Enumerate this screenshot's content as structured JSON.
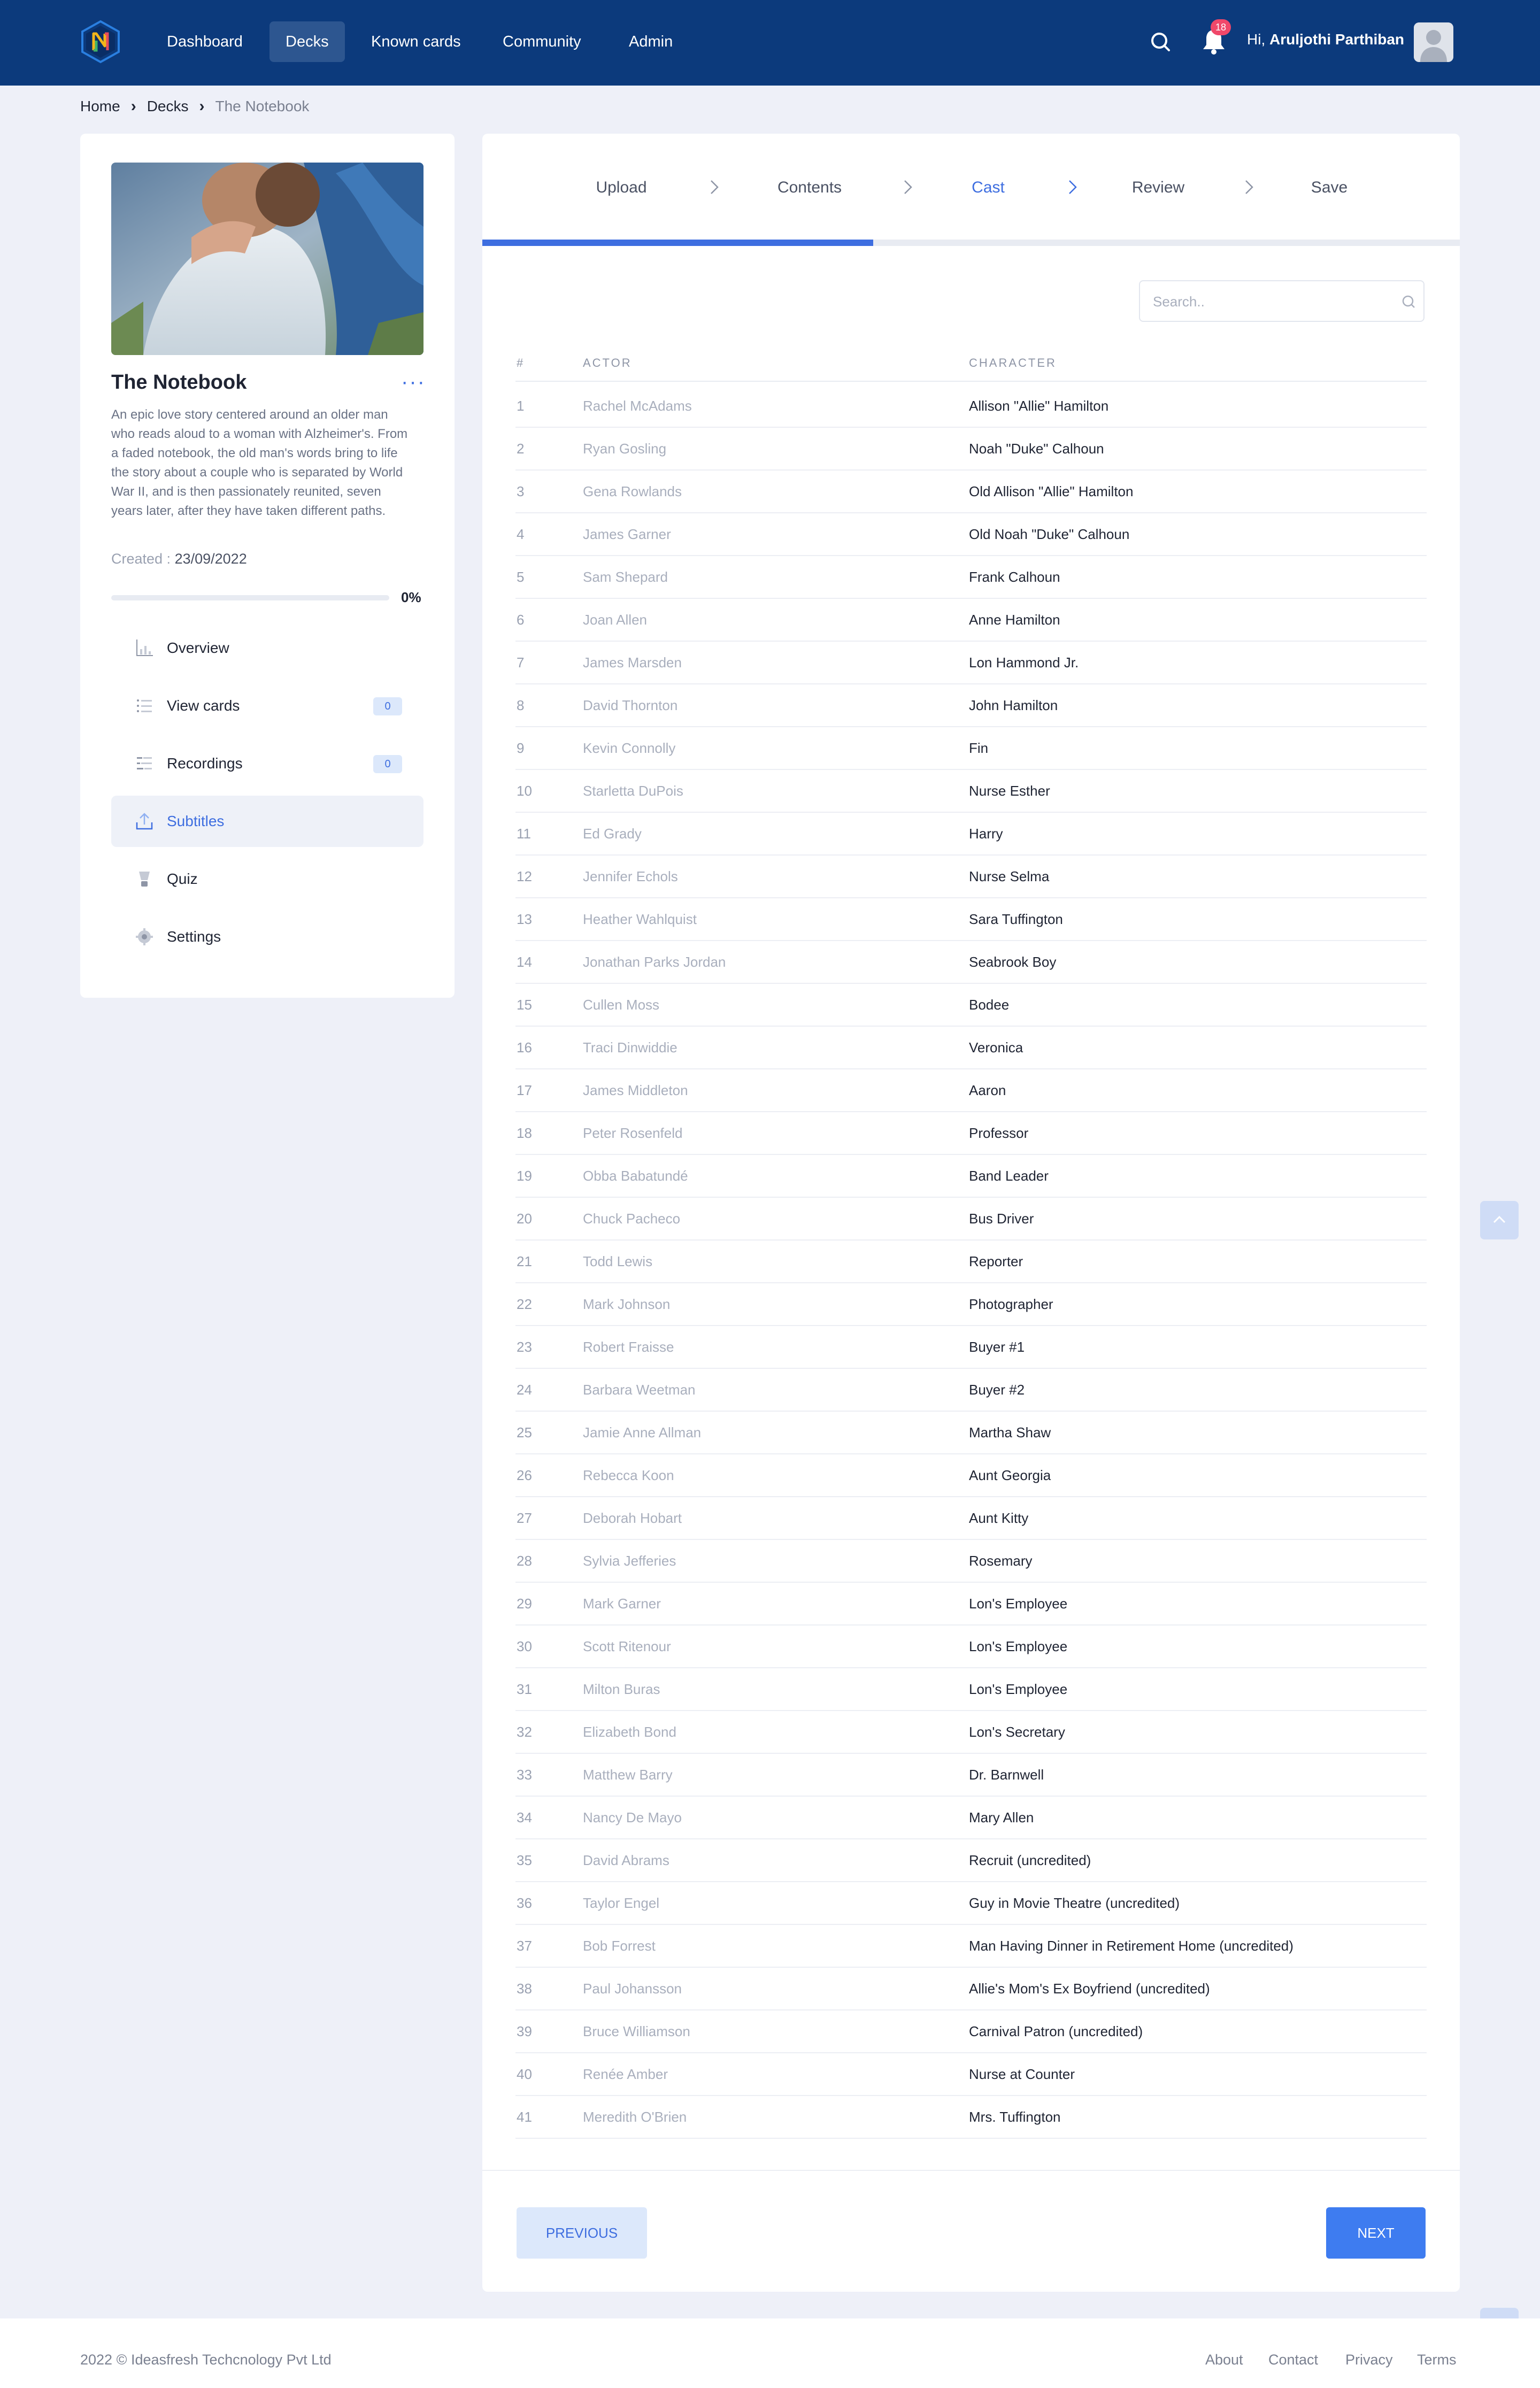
{
  "nav": {
    "logo_letter": "N",
    "items": [
      {
        "label": "Dashboard"
      },
      {
        "label": "Decks",
        "active": true
      },
      {
        "label": "Known cards"
      },
      {
        "label": "Community"
      },
      {
        "label": "Admin"
      }
    ],
    "notification_count": "18",
    "greeting": "Hi,",
    "user_name": "Aruljothi Parthiban"
  },
  "breadcrumb": [
    "Home",
    "Decks",
    "The Notebook"
  ],
  "deck": {
    "title": "The Notebook",
    "more": "···",
    "description": "An epic love story centered around an older man who reads aloud to a woman with Alzheimer's. From a faded notebook, the old man's words bring to life the story about a couple who is separated by World War II, and is then passionately reunited, seven years later, after they have taken different paths.",
    "created_label": "Created :",
    "created_date": "23/09/2022",
    "progress": 0,
    "progress_label": "0%"
  },
  "menu": [
    {
      "label": "Overview",
      "icon": "chart-icon"
    },
    {
      "label": "View cards",
      "icon": "list-icon",
      "badge": "0"
    },
    {
      "label": "Recordings",
      "icon": "recordings-icon",
      "badge": "0"
    },
    {
      "label": "Subtitles",
      "icon": "upload-icon",
      "active": true
    },
    {
      "label": "Quiz",
      "icon": "quiz-icon"
    },
    {
      "label": "Settings",
      "icon": "gear-icon"
    }
  ],
  "steps": [
    {
      "label": "Upload"
    },
    {
      "label": "Contents"
    },
    {
      "label": "Cast",
      "active": true
    },
    {
      "label": "Review"
    },
    {
      "label": "Save"
    }
  ],
  "steps_progress": 0.4,
  "search": {
    "placeholder": "Search..",
    "value": ""
  },
  "table": {
    "headers": {
      "num": "#",
      "actor": "ACTOR",
      "character": "CHARACTER"
    },
    "rows": [
      [
        "1",
        "Rachel McAdams",
        "Allison \"Allie\" Hamilton"
      ],
      [
        "2",
        "Ryan Gosling",
        "Noah \"Duke\" Calhoun"
      ],
      [
        "3",
        "Gena Rowlands",
        "Old Allison \"Allie\" Hamilton"
      ],
      [
        "4",
        "James Garner",
        "Old Noah \"Duke\" Calhoun"
      ],
      [
        "5",
        "Sam Shepard",
        "Frank Calhoun"
      ],
      [
        "6",
        "Joan Allen",
        "Anne Hamilton"
      ],
      [
        "7",
        "James Marsden",
        "Lon Hammond Jr."
      ],
      [
        "8",
        "David Thornton",
        "John Hamilton"
      ],
      [
        "9",
        "Kevin Connolly",
        "Fin"
      ],
      [
        "10",
        "Starletta DuPois",
        "Nurse Esther"
      ],
      [
        "11",
        "Ed Grady",
        "Harry"
      ],
      [
        "12",
        "Jennifer Echols",
        "Nurse Selma"
      ],
      [
        "13",
        "Heather Wahlquist",
        "Sara Tuffington"
      ],
      [
        "14",
        "Jonathan Parks Jordan",
        "Seabrook Boy"
      ],
      [
        "15",
        "Cullen Moss",
        "Bodee"
      ],
      [
        "16",
        "Traci Dinwiddie",
        "Veronica"
      ],
      [
        "17",
        "James Middleton",
        "Aaron"
      ],
      [
        "18",
        "Peter Rosenfeld",
        "Professor"
      ],
      [
        "19",
        "Obba Babatundé",
        "Band Leader"
      ],
      [
        "20",
        "Chuck Pacheco",
        "Bus Driver"
      ],
      [
        "21",
        "Todd Lewis",
        "Reporter"
      ],
      [
        "22",
        "Mark Johnson",
        "Photographer"
      ],
      [
        "23",
        "Robert Fraisse",
        "Buyer #1"
      ],
      [
        "24",
        "Barbara Weetman",
        "Buyer #2"
      ],
      [
        "25",
        "Jamie Anne Allman",
        "Martha Shaw"
      ],
      [
        "26",
        "Rebecca Koon",
        "Aunt Georgia"
      ],
      [
        "27",
        "Deborah Hobart",
        "Aunt Kitty"
      ],
      [
        "28",
        "Sylvia Jefferies",
        "Rosemary"
      ],
      [
        "29",
        "Mark Garner",
        "Lon's Employee"
      ],
      [
        "30",
        "Scott Ritenour",
        "Lon's Employee"
      ],
      [
        "31",
        "Milton Buras",
        "Lon's Employee"
      ],
      [
        "32",
        "Elizabeth Bond",
        "Lon's Secretary"
      ],
      [
        "33",
        "Matthew Barry",
        "Dr. Barnwell"
      ],
      [
        "34",
        "Nancy De Mayo",
        "Mary Allen"
      ],
      [
        "35",
        "David Abrams",
        "Recruit (uncredited)"
      ],
      [
        "36",
        "Taylor Engel",
        "Guy in Movie Theatre (uncredited)"
      ],
      [
        "37",
        "Bob Forrest",
        "Man Having Dinner in Retirement Home (uncredited)"
      ],
      [
        "38",
        "Paul Johansson",
        "Allie's Mom's Ex Boyfriend (uncredited)"
      ],
      [
        "39",
        "Bruce Williamson",
        "Carnival Patron (uncredited)"
      ],
      [
        "40",
        "Renée Amber",
        "Nurse at Counter"
      ],
      [
        "41",
        "Meredith O'Brien",
        "Mrs. Tuffington"
      ]
    ]
  },
  "buttons": {
    "previous": "PREVIOUS",
    "next": "NEXT"
  },
  "footer": {
    "copyright": "2022 © Ideasfresh Techcnology Pvt Ltd",
    "links": [
      "About",
      "Contact",
      "Privacy",
      "Terms"
    ]
  },
  "colors": {
    "nav_bg": "#0c3a7c",
    "accent": "#3e6ee0",
    "page_bg": "#eef0f8",
    "badge_red": "#f0486a"
  }
}
